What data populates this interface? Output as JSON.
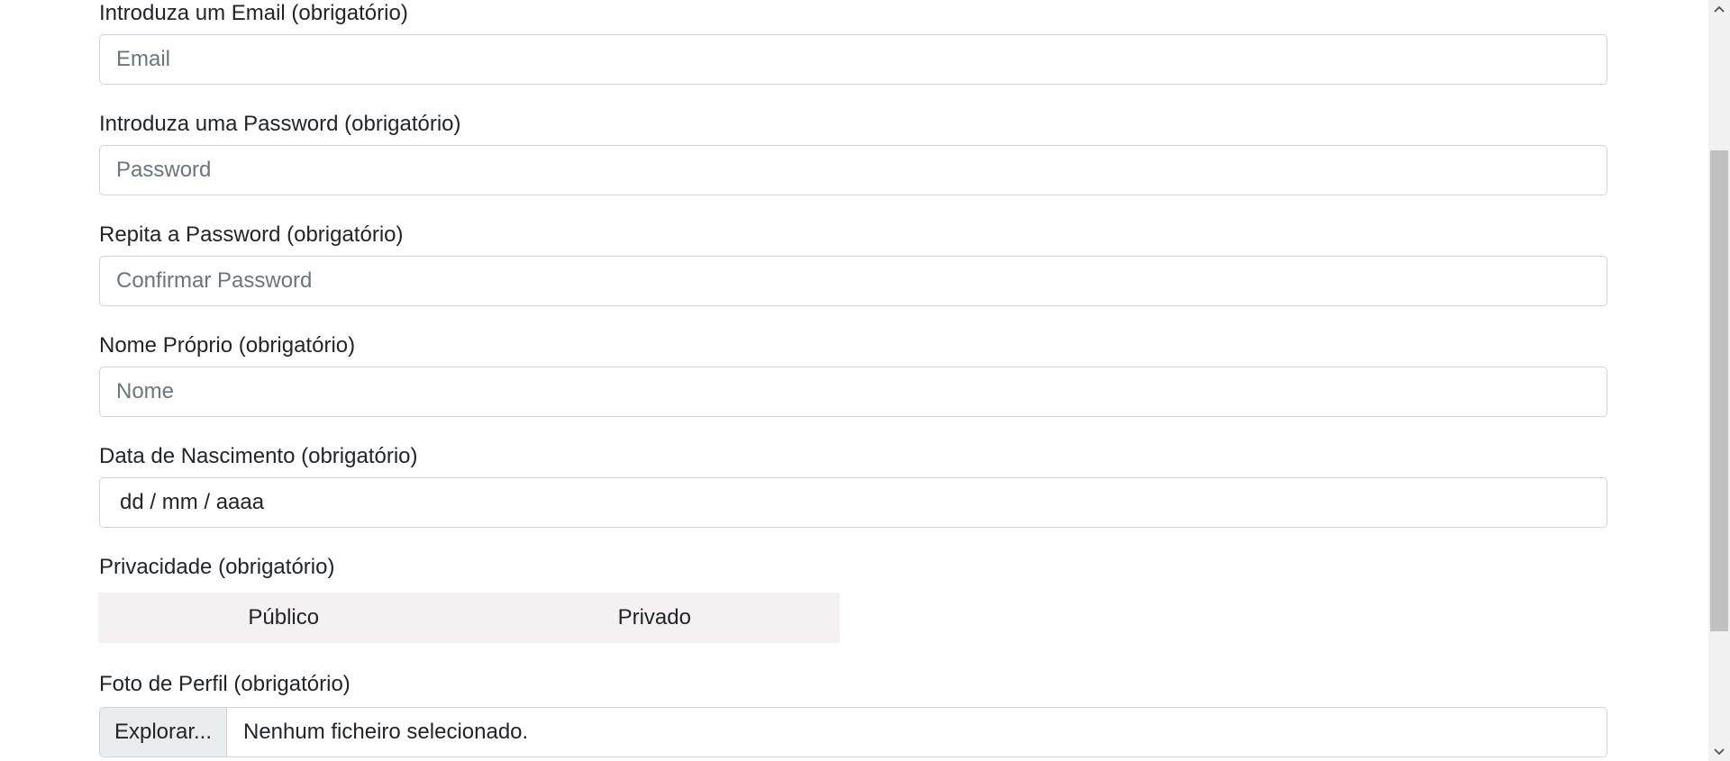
{
  "form": {
    "email": {
      "label": "Introduza um Email (obrigatório)",
      "placeholder": "Email"
    },
    "password": {
      "label": "Introduza uma Password (obrigatório)",
      "placeholder": "Password"
    },
    "confirm_password": {
      "label": "Repita a Password (obrigatório)",
      "placeholder": "Confirmar Password"
    },
    "first_name": {
      "label": "Nome Próprio (obrigatório)",
      "placeholder": "Nome"
    },
    "birth_date": {
      "label": "Data de Nascimento (obrigatório)",
      "value": "dd / mm / aaaa"
    },
    "privacy": {
      "label": "Privacidade (obrigatório)",
      "options": [
        "Público",
        "Privado"
      ]
    },
    "profile_photo": {
      "label": "Foto de Perfil (obrigatório)",
      "browse_label": "Explorar...",
      "file_status": "Nenhum ficheiro selecionado."
    }
  },
  "scrollbar": {
    "up_icon": "chevron-up-icon",
    "down_icon": "chevron-down-icon"
  },
  "colors": {
    "border": "#ced4da",
    "placeholder": "#6c757d",
    "privacy_bg": "#f5f0f2",
    "browse_bg": "#e9ecef"
  }
}
